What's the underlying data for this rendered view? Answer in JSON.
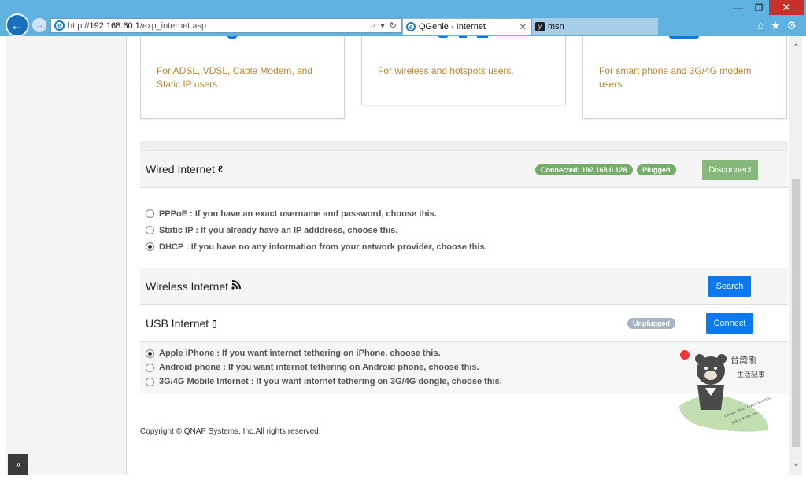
{
  "browser": {
    "url_prefix": "http://",
    "url_host": "192.168.60.1",
    "url_path": "/exp_internet.asp",
    "tabs": [
      {
        "label": "QGenie - Internet"
      },
      {
        "label": "msn"
      }
    ]
  },
  "cards": [
    {
      "description": "For ADSL, VDSL, Cable Modem, and Static IP users."
    },
    {
      "description": "For wireless and hotspots users."
    },
    {
      "description": "For smart phone and 3G/4G modem users."
    }
  ],
  "wired": {
    "title": "Wired Internet",
    "status_connected": "Connected: 192.168.0.128",
    "status_plugged": "Plugged",
    "button": "Disconnect",
    "options": [
      {
        "label": "PPPoE : If you have an exact username and password, choose this.",
        "checked": false
      },
      {
        "label": "Static IP : If you already have an IP adddress, choose this.",
        "checked": false
      },
      {
        "label": "DHCP : If you have no any information from your network provider, choose this.",
        "checked": true
      }
    ]
  },
  "wireless": {
    "title": "Wireless Internet",
    "button": "Search"
  },
  "usb": {
    "title": "USB Internet",
    "status": "Unplugged",
    "button": "Connect",
    "options": [
      {
        "label": "Apple iPhone : If you want internet tethering on iPhone, choose this.",
        "checked": true
      },
      {
        "label": "Android phone : If you want internet tethering on Android phone, choose this.",
        "checked": false
      },
      {
        "label": "3G/4G Mobile Internet : If you want internet tethering on 3G/4G dongle, choose this.",
        "checked": false
      }
    ]
  },
  "footer": {
    "copyright": "Copyright © QNAP Systems, Inc.All rights reserved."
  },
  "watermark": {
    "text_line1": "台灣熊",
    "text_line2": "生活記事",
    "text_curve1": "Taiwan Bear Lives Sharing",
    "text_curve2": "gsk.pixnet.net"
  },
  "colors": {
    "accent_blue": "#0a78f0",
    "green": "#76ad6b",
    "muted_gray": "#a7b5c2",
    "card_text": "#b8862d",
    "chrome": "#5fb1df"
  }
}
